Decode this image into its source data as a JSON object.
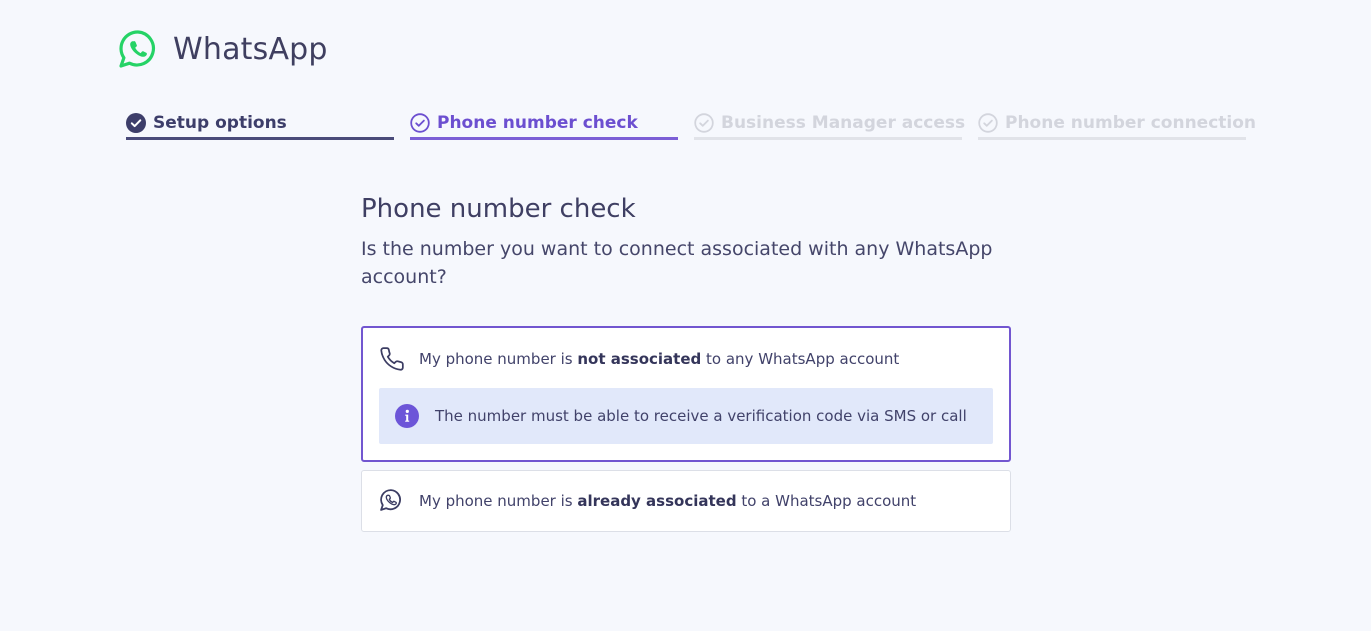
{
  "app": {
    "title": "WhatsApp"
  },
  "colors": {
    "accent": "#7256d0",
    "brand": "#25d366",
    "done": "#4a4b7a",
    "inactive": "#d3d5dd",
    "info_bg": "#e1e8fa"
  },
  "steps": [
    {
      "label": "Setup options",
      "state": "completed",
      "icon": "check-filled-icon"
    },
    {
      "label": "Phone number check",
      "state": "active",
      "icon": "check-outline-icon"
    },
    {
      "label": "Business Manager access",
      "state": "pending",
      "icon": "check-outline-icon"
    },
    {
      "label": "Phone number connection",
      "state": "pending",
      "icon": "check-outline-icon"
    }
  ],
  "main": {
    "heading": "Phone number check",
    "subtitle": "Is the number you want to connect associated with any WhatsApp account?"
  },
  "options": [
    {
      "icon": "phone-icon",
      "selected": true,
      "prefix": "My phone number is ",
      "emphasis": "not associated",
      "suffix": " to any WhatsApp account",
      "info": {
        "icon": "info-icon",
        "text": "The number must be able to receive a verification code via SMS or call"
      }
    },
    {
      "icon": "whatsapp-icon",
      "selected": false,
      "prefix": "My phone number is ",
      "emphasis": "already associated",
      "suffix": " to a WhatsApp account"
    }
  ]
}
